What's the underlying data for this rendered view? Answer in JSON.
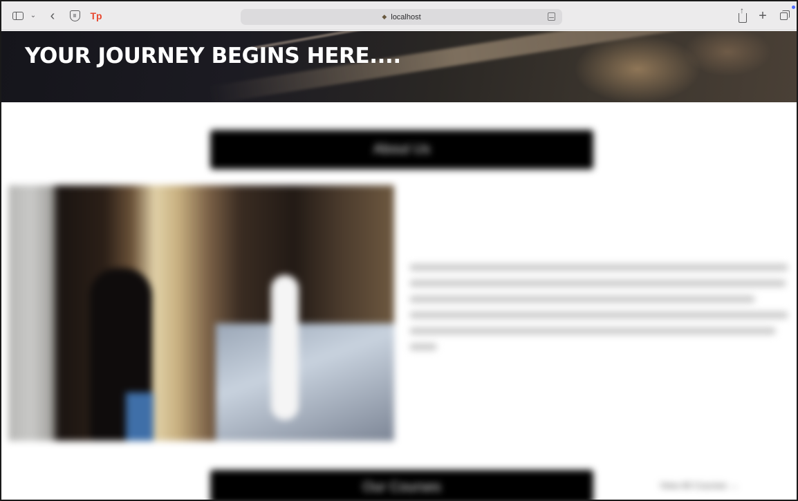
{
  "browser": {
    "url": "localhost",
    "icons": {
      "sidebar": "sidebar-toggle-icon",
      "dropdown": "chevron-down-icon",
      "back": "chevron-left-icon",
      "privacy": "shield-icon",
      "extension": "tp-extension-icon",
      "site": "site-favicon",
      "reader": "reader-mode-icon",
      "share": "share-icon",
      "new_tab": "plus-icon",
      "tab_overview": "tab-overview-icon"
    },
    "extension_label": "Tp",
    "accent_dot_color": "#4f6bff"
  },
  "hero": {
    "title": "YOUR JOURNEY BEGINS HERE...."
  },
  "about": {
    "button_label": "About Us"
  },
  "courses": {
    "button_label": "Our Courses",
    "link_label": "View All Courses →"
  },
  "colors": {
    "hero_text": "#ffffff",
    "section_bar": "#000000",
    "extension_red": "#e8472e"
  }
}
